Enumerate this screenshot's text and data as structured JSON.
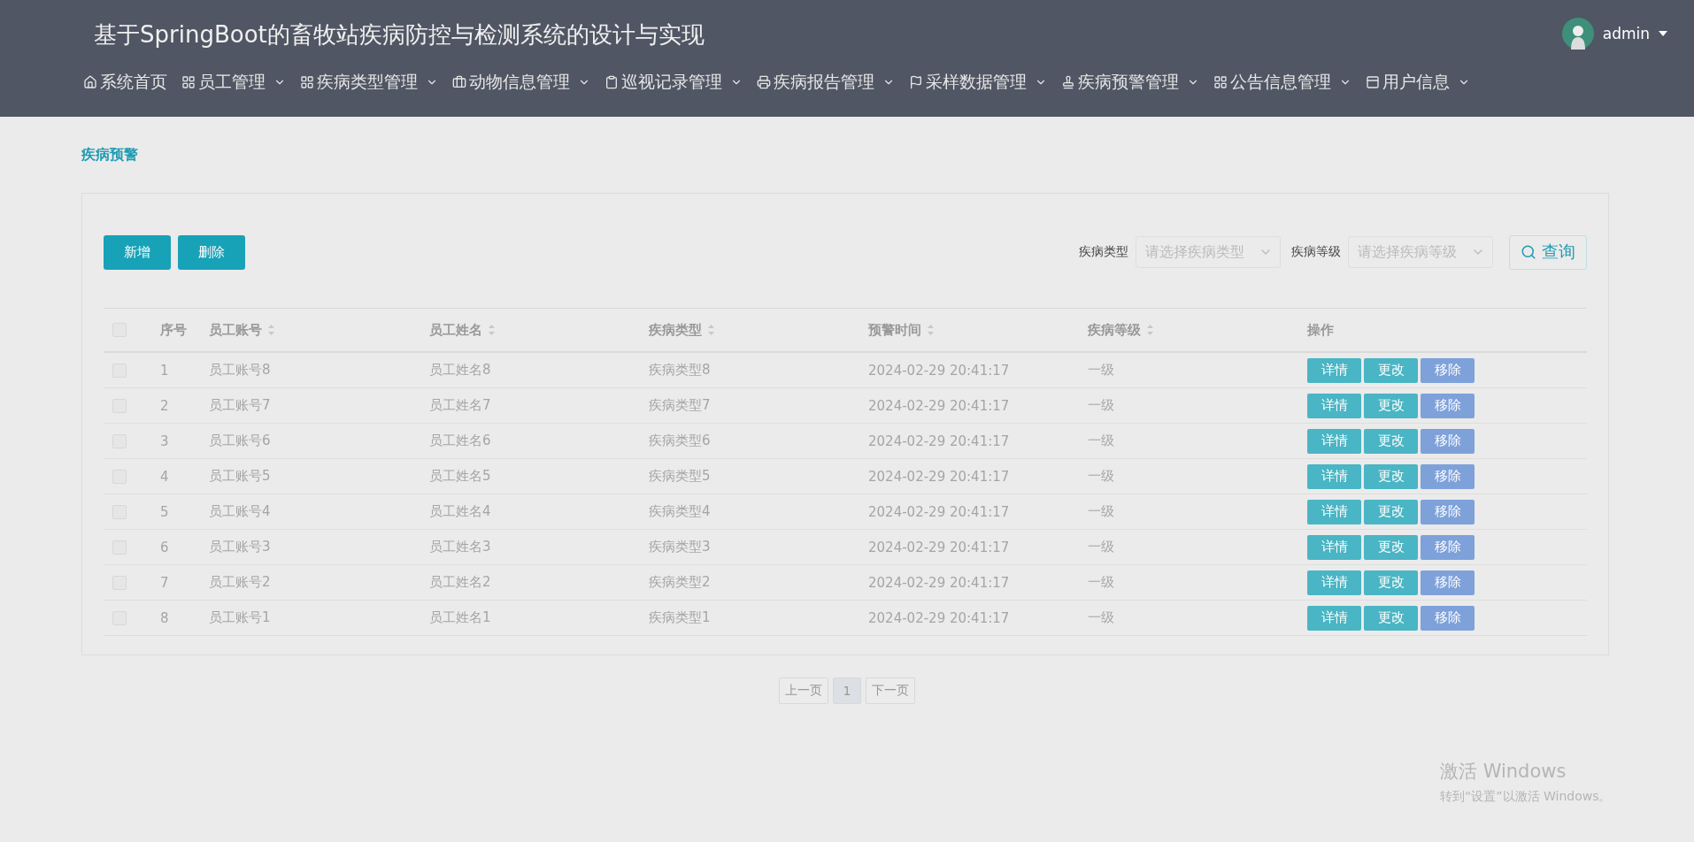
{
  "header": {
    "title": "基于SpringBoot的畜牧站疾病防控与检测系统的设计与实现",
    "user": "admin"
  },
  "nav": [
    {
      "label": "系统首页",
      "has_menu": false
    },
    {
      "label": "员工管理",
      "has_menu": true
    },
    {
      "label": "疾病类型管理",
      "has_menu": true
    },
    {
      "label": "动物信息管理",
      "has_menu": true
    },
    {
      "label": "巡视记录管理",
      "has_menu": true
    },
    {
      "label": "疾病报告管理",
      "has_menu": true
    },
    {
      "label": "采样数据管理",
      "has_menu": true
    },
    {
      "label": "疾病预警管理",
      "has_menu": true
    },
    {
      "label": "公告信息管理",
      "has_menu": true
    },
    {
      "label": "用户信息",
      "has_menu": true
    }
  ],
  "breadcrumb": "疾病预警",
  "toolbar": {
    "buttons": [
      "新增",
      "删除"
    ],
    "filters": [
      {
        "label": "疾病类型",
        "placeholder": "请选择疾病类型"
      },
      {
        "label": "疾病等级",
        "placeholder": "请选择疾病等级"
      }
    ],
    "search": "查询"
  },
  "table": {
    "select_all": {
      "checked": false
    },
    "columns": [
      {
        "label": "序号",
        "sortable": false
      },
      {
        "label": "员工账号",
        "sortable": true
      },
      {
        "label": "员工姓名",
        "sortable": true
      },
      {
        "label": "疾病类型",
        "sortable": true
      },
      {
        "label": "预警时间",
        "sortable": true
      },
      {
        "label": "疾病等级",
        "sortable": true
      },
      {
        "label": "操作",
        "sortable": false
      }
    ],
    "rows": [
      {
        "checked": false,
        "cells": [
          "1",
          "员工账号8",
          "员工姓名8",
          "疾病类型8",
          "2024-02-29 20:41:17",
          "一级"
        ],
        "actions": [
          {
            "label": "详情",
            "kind": "primary"
          },
          {
            "label": "更改",
            "kind": "primary"
          },
          {
            "label": "移除",
            "kind": "danger"
          }
        ]
      },
      {
        "checked": false,
        "cells": [
          "2",
          "员工账号7",
          "员工姓名7",
          "疾病类型7",
          "2024-02-29 20:41:17",
          "一级"
        ],
        "actions": [
          {
            "label": "详情",
            "kind": "primary"
          },
          {
            "label": "更改",
            "kind": "primary"
          },
          {
            "label": "移除",
            "kind": "danger"
          }
        ]
      },
      {
        "checked": false,
        "cells": [
          "3",
          "员工账号6",
          "员工姓名6",
          "疾病类型6",
          "2024-02-29 20:41:17",
          "一级"
        ],
        "actions": [
          {
            "label": "详情",
            "kind": "primary"
          },
          {
            "label": "更改",
            "kind": "primary"
          },
          {
            "label": "移除",
            "kind": "danger"
          }
        ]
      },
      {
        "checked": false,
        "cells": [
          "4",
          "员工账号5",
          "员工姓名5",
          "疾病类型5",
          "2024-02-29 20:41:17",
          "一级"
        ],
        "actions": [
          {
            "label": "详情",
            "kind": "primary"
          },
          {
            "label": "更改",
            "kind": "primary"
          },
          {
            "label": "移除",
            "kind": "danger"
          }
        ]
      },
      {
        "checked": false,
        "cells": [
          "5",
          "员工账号4",
          "员工姓名4",
          "疾病类型4",
          "2024-02-29 20:41:17",
          "一级"
        ],
        "actions": [
          {
            "label": "详情",
            "kind": "primary"
          },
          {
            "label": "更改",
            "kind": "primary"
          },
          {
            "label": "移除",
            "kind": "danger"
          }
        ]
      },
      {
        "checked": false,
        "cells": [
          "6",
          "员工账号3",
          "员工姓名3",
          "疾病类型3",
          "2024-02-29 20:41:17",
          "一级"
        ],
        "actions": [
          {
            "label": "详情",
            "kind": "primary"
          },
          {
            "label": "更改",
            "kind": "primary"
          },
          {
            "label": "移除",
            "kind": "danger"
          }
        ]
      },
      {
        "checked": false,
        "cells": [
          "7",
          "员工账号2",
          "员工姓名2",
          "疾病类型2",
          "2024-02-29 20:41:17",
          "一级"
        ],
        "actions": [
          {
            "label": "详情",
            "kind": "primary"
          },
          {
            "label": "更改",
            "kind": "primary"
          },
          {
            "label": "移除",
            "kind": "danger"
          }
        ]
      },
      {
        "checked": false,
        "cells": [
          "8",
          "员工账号1",
          "员工姓名1",
          "疾病类型1",
          "2024-02-29 20:41:17",
          "一级"
        ],
        "actions": [
          {
            "label": "详情",
            "kind": "primary"
          },
          {
            "label": "更改",
            "kind": "primary"
          },
          {
            "label": "移除",
            "kind": "danger"
          }
        ]
      }
    ]
  },
  "pagination": {
    "prev": "上一页",
    "pages": [
      {
        "label": "1",
        "selected": true
      }
    ],
    "next": "下一页"
  },
  "os_notice": {
    "title": "激活 Windows",
    "text": "转到“设置”以激活 Windows。"
  }
}
